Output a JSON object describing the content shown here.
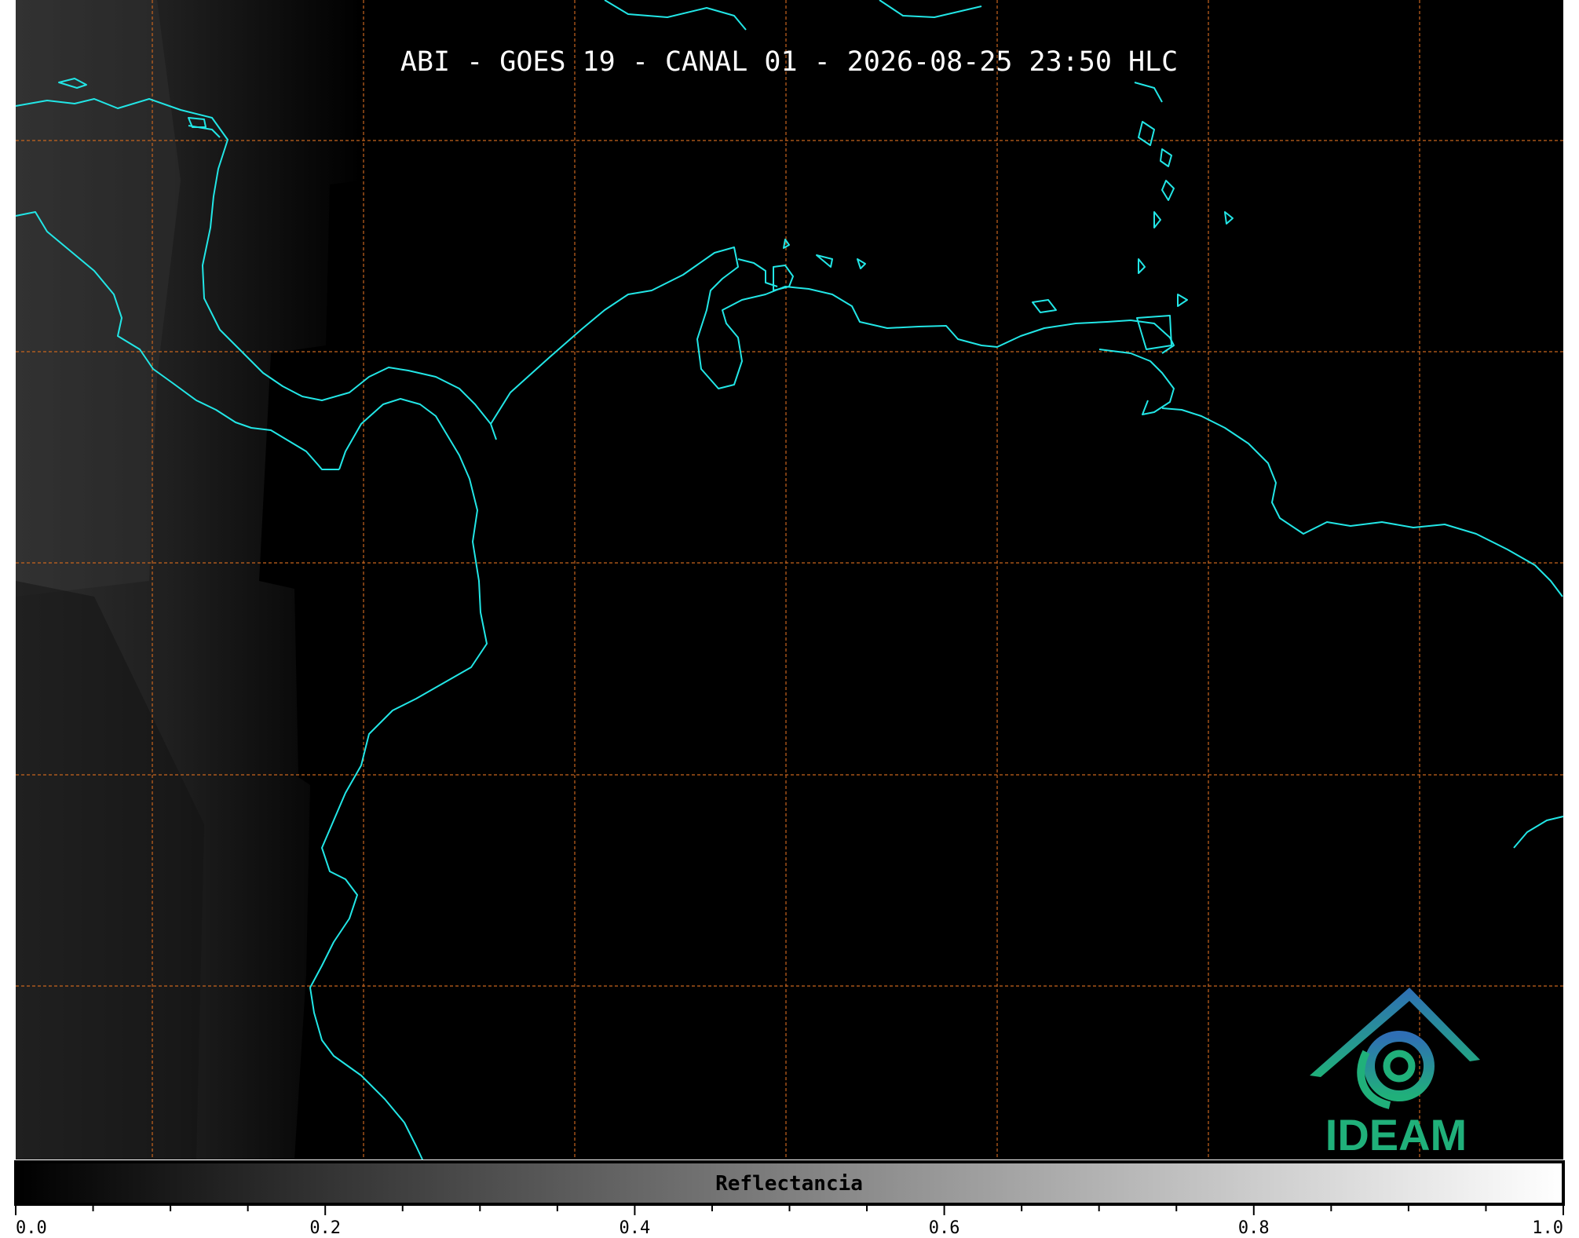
{
  "map": {
    "title": "ABI - GOES 19 - CANAL 01 - 2026-08-25 23:50 HLC",
    "colors": {
      "background": "#000000",
      "coastline": "#22e6e6",
      "graticule": "#c8651e"
    }
  },
  "colorbar": {
    "label": "Reflectancia",
    "range": [
      0.0,
      1.0
    ],
    "ticks": [
      "0.0",
      "0.2",
      "0.4",
      "0.6",
      "0.8",
      "1.0"
    ],
    "colors": {
      "low": "#000000",
      "high": "#ffffff"
    }
  },
  "logo": {
    "text": "IDEAM",
    "colors": {
      "blue": "#2f6fb5",
      "green": "#20b07a"
    }
  }
}
